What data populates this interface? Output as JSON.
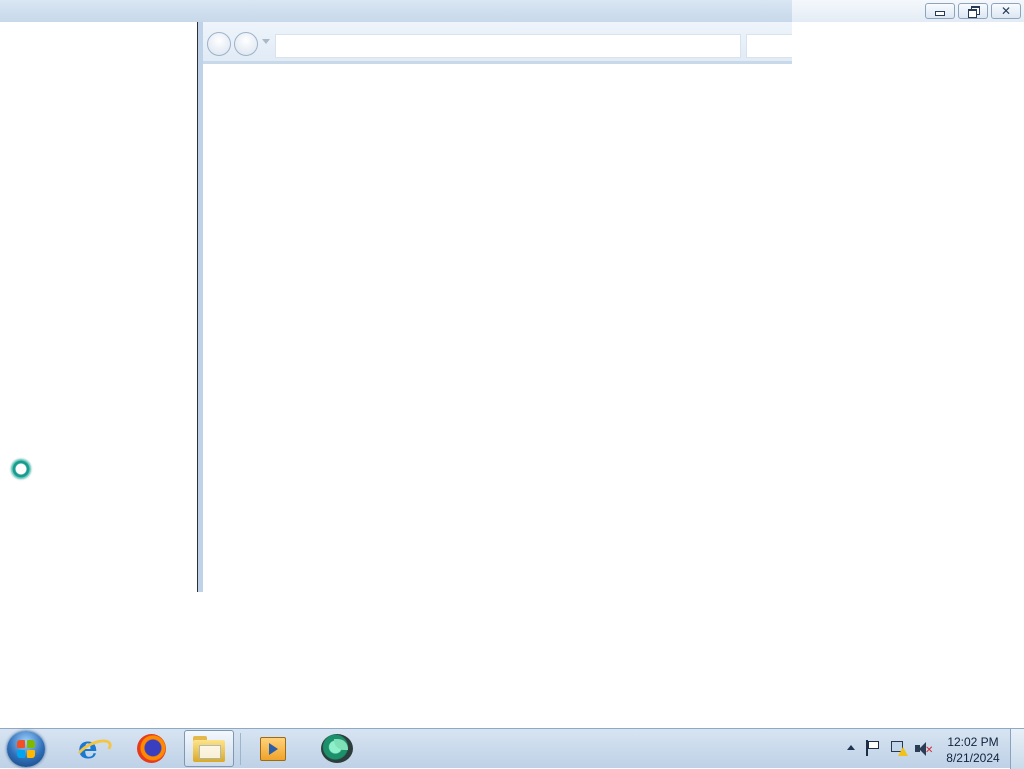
{
  "window": {
    "caption_buttons": {
      "minimize_icon": "minimize-icon",
      "maximize_icon": "restore-icon",
      "close_icon": "close-icon",
      "close_glyph": "✕"
    },
    "navigation": {
      "back_icon": "back-arrow-icon",
      "forward_icon": "forward-arrow-icon",
      "address_value": "",
      "search_value": ""
    },
    "left_pane": {
      "busy_indicator_icon": "busy-ring-icon"
    }
  },
  "taskbar": {
    "start_icon": "windows-start-icon",
    "pinned": [
      {
        "name": "internet-explorer-icon"
      },
      {
        "name": "firefox-icon"
      },
      {
        "name": "windows-explorer-icon",
        "active": true
      },
      {
        "name": "media-player-icon"
      },
      {
        "name": "green-app-icon"
      }
    ],
    "tray": {
      "show_hidden_icon": "tray-up-arrow-icon",
      "action_center_icon": "action-center-flag-icon",
      "network_icon": "network-warning-icon",
      "volume_icon": "volume-muted-icon"
    },
    "clock": {
      "time": "12:02 PM",
      "date": "8/21/2024"
    }
  },
  "colors": {
    "taskbar_bg": "#bed1e6",
    "window_border": "#bfd2e7",
    "start_orb": "#2f6fb8"
  }
}
